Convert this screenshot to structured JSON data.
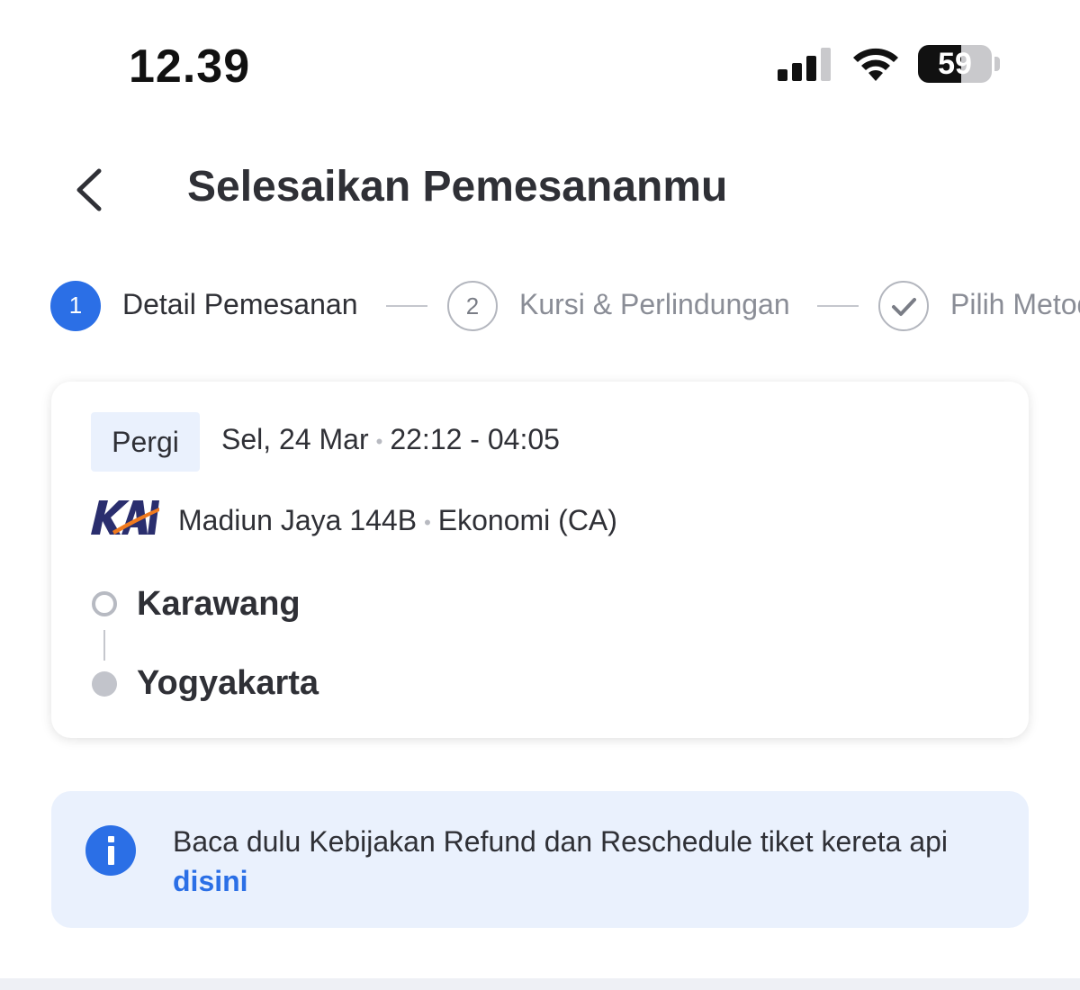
{
  "status_bar": {
    "time": "12.39",
    "battery_level": "59",
    "battery_fraction": 0.59
  },
  "header": {
    "title": "Selesaikan Pemesananmu"
  },
  "stepper": {
    "steps": [
      {
        "number": "1",
        "label": "Detail Pemesanan",
        "state": "active"
      },
      {
        "number": "2",
        "label": "Kursi & Perlindungan",
        "state": "inactive"
      },
      {
        "number": "",
        "label": "Pilih Metode",
        "state": "inactive",
        "icon": "check-icon"
      }
    ]
  },
  "trip": {
    "badge": "Pergi",
    "date": "Sel, 24 Mar",
    "time_range": "22:12 - 04:05",
    "operator_logo": "KAI",
    "train_name": "Madiun Jaya 144B",
    "train_class": "Ekonomi (CA)",
    "origin": "Karawang",
    "destination": "Yogyakarta"
  },
  "info_banner": {
    "icon": "info-icon",
    "text": "Baca dulu Kebijakan Refund dan Reschedule tiket kereta api",
    "link_text": "disini"
  },
  "colors": {
    "accent": "#2b6fe6",
    "badge_bg": "#eaf1fd",
    "text": "#2f3036",
    "muted": "#8a8d96",
    "kai_navy": "#2a2e6e",
    "kai_orange": "#f07a1e"
  }
}
